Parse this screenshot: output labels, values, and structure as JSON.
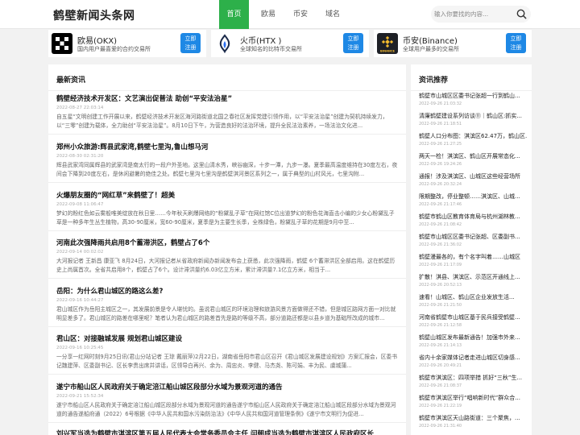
{
  "header": {
    "logo": "鹤壁新闻头条网",
    "nav": [
      "首页",
      "欧易",
      "币安",
      "域名"
    ],
    "search_placeholder": "输入你要找的内容...",
    "search_icon": "search-icon"
  },
  "exchanges": [
    {
      "name": "欧易(OKX)",
      "desc": "国内用户最喜爱的合约交易所",
      "btn": "立即\n注册",
      "logo_icon": "okx-logo"
    },
    {
      "name": "火币(HTX )",
      "desc": "全球知名的比特币交易所",
      "btn": "立即\n注册",
      "logo_icon": "htx-logo"
    },
    {
      "name": "币安(Binance)",
      "desc": "全球用户最多的交易所",
      "btn": "立即\n注册",
      "logo_icon": "binance-logo"
    }
  ],
  "news": {
    "title": "最新资讯",
    "articles": [
      {
        "title": "鹤壁经济技术开发区：文艺演出促普法 助创“平安法治星”",
        "date": "2022-08-27 22:03:14",
        "summary": "自五星“文明创建工作开展以来，鹤壁经济技术开发区海河路街道北国之春社区发挥党建引领作用，以“平安法治星”创建为契机持续发力，以“三零”创建为载体，全力助创“平安法治星”。8月10日下午，为营造良好的法治环境，提升全民法治素养，一场法治文化进..."
      },
      {
        "title": "郑州小众旅游:辉县武家湾,鹤壁七里沟,鲁山想马河",
        "date": "2022-08-30 02:31:20",
        "summary": "辉县武家湾同属辉县的武家湾是南太行的一段户外圣地。这里山清水秀，峡谷幽深，十步一潭，九步一瀑。夏季最高温度维持在30度左右，夜间会下降到20度左右，是休闲避暑的绝佳之处。鹤壁七里沟七里沟是鹤壁淇河景区系列之一，属于典型的山村风光，七里沟附..."
      },
      {
        "title": "火爆朋友圈的“网红草”来鹤壁了！超美",
        "date": "2022-09-08 11:06:47",
        "summary": "梦幻的粉红色如云雾般唯美绽放在秋日里……今年秋天刷爆网络的“粉黛乱子草”在网红馆C位出道梦幻的粉色花海直击小编的少女心粉黛乱子草是一种多年生丛生植物，高30-90厘米，宽60-90厘米，夏季是为主要生长季，全株绿色，粉黛乱子草的花期是9月中至..."
      },
      {
        "title": "河南此次强降雨共启用8个蓄滞洪区，鹤壁占了6个",
        "date": "2022-09-14 00:02:02",
        "summary": "大河报记者 王新昌 康亚飞 8月24日，大河报记者从省政府新闻办新闻发布会上获悉，此次强降雨，鹤壁 6个蓄滞洪区全部启用。这在鹤壁历史上尚属首次。全省共启用8个，鹤壁占了6个。设计滞洪量约6.03亿立方米，累计滞洪量7.1亿立方米，相当于..."
      },
      {
        "title": "岳阳：为什么君山城区的路这么差?",
        "date": "2022-09-16 10:44:27",
        "summary": "君山城区作为岳阳主城区之一，其发展前景是令人堪忧的。虽说君山城区的环境治理和旅游风景方面做得还不错，但是城区路网方面一对比就明显差多了。君山城区的路差在哪里呢？笔者认为君山城区的路差首先是路的等级不高，部分道路还都是以县乡道为基础所改成的城市..."
      },
      {
        "title": "君山区：对接融城发展 规划君山城区建设",
        "date": "2022-09-16 10:25:45",
        "summary": "一分享一红网时刻9月25日讯(君山分站记者 王琼 戴丽萍)2月22日，湖南省岳阳市君山区召开《君山城区发展建设规划》方案汇报会，区委书记魏建萍、区委副书记、区长李贵出席并讲话，区领导白再兴、余为、周忠炎、李健、马杰尧、陈可娟、丰为民、虞城蒲..."
      },
      {
        "title": "遂宁市船山区人民政府关于确定涪江船山城区段部分水域为景观河道的通告",
        "date": "2022-09-21 15:52:34",
        "summary": "遂宁市船山区人民政府关于确定涪江船山城区段部分水域为景观河道的通告遂宁市船山区人民政府关于确定涪江船山城区段部分水域为景观河道的通告遂船府通（2022）6号根据《中华人民共和国水污染防治法》《中华人民共和国河道管理条例》《遂宁市文明行为促进..."
      },
      {
        "title": "刘兴军当选为鹤壁市淇滨区第五届人民代表大会常务委员会主任 闫朝成当选为鹤壁市淇滨区人民政府区长",
        "date": "",
        "summary": ""
      }
    ]
  },
  "recommended": {
    "title": "资讯推荐",
    "items": [
      {
        "title": "鹤壁市山城区区委书记张超一行到鹤山...",
        "date": "2022-09-26 21:03:32"
      },
      {
        "title": "清廉鹤壁建设系列访谈⑪｜鹤山区:抓实...",
        "date": "2022-09-26 21:18:51"
      },
      {
        "title": "鹤壁人口分布图：淇滨区62.47万，鹤山区...",
        "date": "2022-09-26 21:27:25"
      },
      {
        "title": "两天一检！淇滨区、鹤山区开展常态化...",
        "date": "2022-09-26 19:24:26"
      },
      {
        "title": "通报！涉及淇滨区、山城区这些经营场所",
        "date": "2022-09-26 20:32:24"
      },
      {
        "title": "限期整改，停业整顿……淇滨区、山城...",
        "date": "2022-09-26 21:17:46"
      },
      {
        "title": "鹤壁市鹤山区教育体育局与杭州湖林教...",
        "date": "2022-09-26 21:08:42"
      },
      {
        "title": "鹤壁市山城区区委书记张超、区委副书...",
        "date": "2022-09-26 21:36:02"
      },
      {
        "title": "鹤壁漫最各的，有个名字叫着……山城区",
        "date": "2022-09-26 21:17:09"
      },
      {
        "title": "扩散！淇县、淇滨区、示范区开通线上...",
        "date": "2022-09-26 20:52:13"
      },
      {
        "title": "速看！山城区、鹤山区企业发放生活...",
        "date": "2022-09-26 21:21:50"
      },
      {
        "title": "河南省鹤壁市山城区基于民兵接受鹤壁...",
        "date": "2022-09-26 21:12:58"
      },
      {
        "title": "鹤壁山城区发布最新通告！加强市外来...",
        "date": "2022-09-26 21:14:13"
      },
      {
        "title": "省内十余家媒体记者走进山城区切身感...",
        "date": "2022-09-26 20:49:21"
      },
      {
        "title": "鹤壁市淇滨区：四项举措 抓好“三秋”生...",
        "date": "2022-09-26 21:08:37"
      },
      {
        "title": "鹤壁市淇滨区举行“唱响新时代”群众合...",
        "date": "2022-09-26 21:22:19"
      },
      {
        "title": "鹤壁市淇滨区天山路街道：三个聚焦，...",
        "date": "2022-09-26 21:31:40"
      }
    ]
  },
  "colors": {
    "accent": "#2db04a",
    "button": "#1e88e5"
  }
}
